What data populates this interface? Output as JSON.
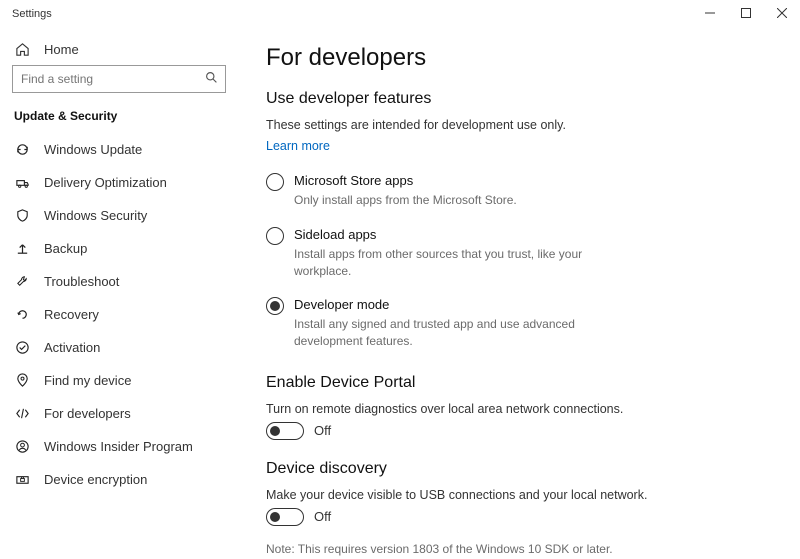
{
  "window": {
    "title": "Settings"
  },
  "sidebar": {
    "home_label": "Home",
    "search_placeholder": "Find a setting",
    "category_label": "Update & Security",
    "items": [
      {
        "label": "Windows Update"
      },
      {
        "label": "Delivery Optimization"
      },
      {
        "label": "Windows Security"
      },
      {
        "label": "Backup"
      },
      {
        "label": "Troubleshoot"
      },
      {
        "label": "Recovery"
      },
      {
        "label": "Activation"
      },
      {
        "label": "Find my device"
      },
      {
        "label": "For developers"
      },
      {
        "label": "Windows Insider Program"
      },
      {
        "label": "Device encryption"
      }
    ]
  },
  "main": {
    "page_title": "For developers",
    "dev_features": {
      "title": "Use developer features",
      "description": "These settings are intended for development use only.",
      "learn_more": "Learn more",
      "options": [
        {
          "label": "Microsoft Store apps",
          "sub": "Only install apps from the Microsoft Store."
        },
        {
          "label": "Sideload apps",
          "sub": "Install apps from other sources that you trust, like your workplace."
        },
        {
          "label": "Developer mode",
          "sub": "Install any signed and trusted app and use advanced development features."
        }
      ]
    },
    "device_portal": {
      "title": "Enable Device Portal",
      "description": "Turn on remote diagnostics over local area network connections.",
      "toggle_state": "Off"
    },
    "device_discovery": {
      "title": "Device discovery",
      "description": "Make your device visible to USB connections and your local network.",
      "toggle_state": "Off",
      "note": "Note: This requires version 1803 of the Windows 10 SDK or later."
    }
  }
}
